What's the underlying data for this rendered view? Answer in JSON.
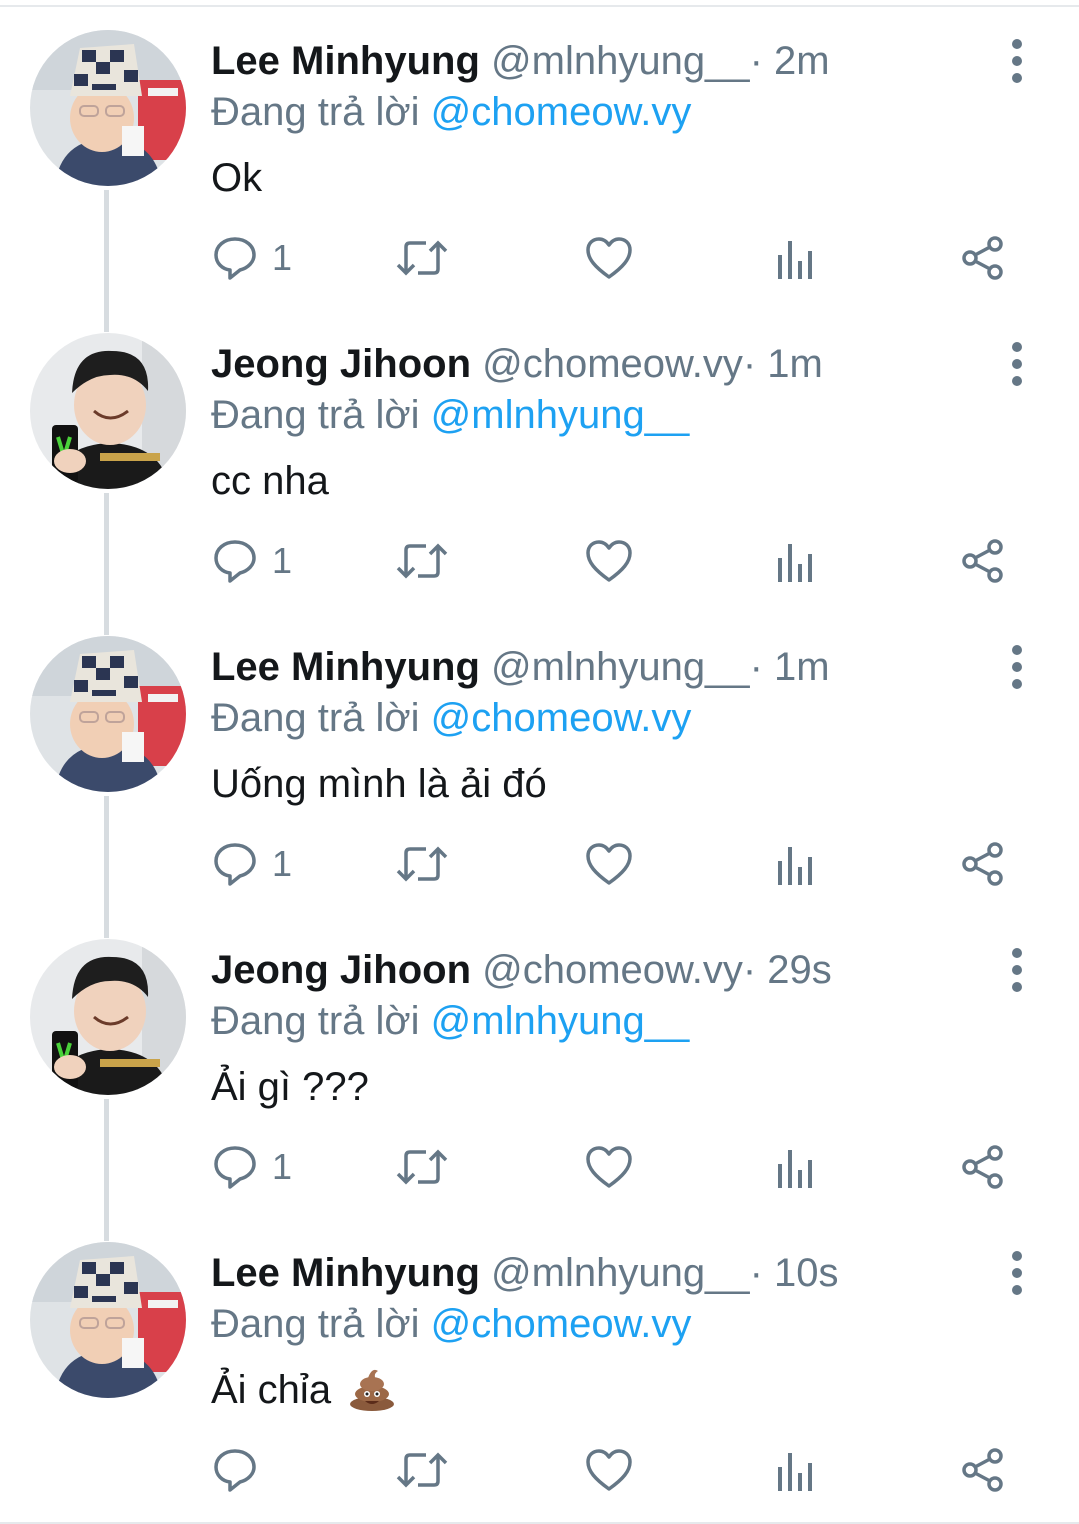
{
  "colors": {
    "text_primary": "#14171a",
    "text_secondary": "#657786",
    "mention": "#1da1f2",
    "thread_line": "#d7dce0"
  },
  "icons": [
    "comment-icon",
    "retweet-icon",
    "like-icon",
    "analytics-icon",
    "share-icon",
    "more-options-icon"
  ],
  "tweets": [
    {
      "author": "Lee Minhyung",
      "handle": "@mlnhyung__",
      "separator": "·",
      "time": "2m",
      "reply_prefix": "Đang trả lời",
      "reply_to": "@chomeow.vy",
      "text": "Ok",
      "reply_count": "1",
      "avatar": "lee"
    },
    {
      "author": "Jeong Jihoon",
      "handle": "@chomeow.vy",
      "separator": "·",
      "time": "1m",
      "reply_prefix": "Đang trả lời",
      "reply_to": "@mlnhyung__",
      "text": "cc nha",
      "reply_count": "1",
      "avatar": "jeong"
    },
    {
      "author": "Lee Minhyung",
      "handle": "@mlnhyung__",
      "separator": "·",
      "time": "1m",
      "reply_prefix": "Đang trả lời",
      "reply_to": "@chomeow.vy",
      "text": "Uống mình là ải đó",
      "reply_count": "1",
      "avatar": "lee"
    },
    {
      "author": "Jeong Jihoon",
      "handle": "@chomeow.vy",
      "separator": "·",
      "time": "29s",
      "reply_prefix": "Đang trả lời",
      "reply_to": "@mlnhyung__",
      "text": "Ải gì ???",
      "reply_count": "1",
      "avatar": "jeong"
    },
    {
      "author": "Lee Minhyung",
      "handle": "@mlnhyung__",
      "separator": "·",
      "time": "10s",
      "reply_prefix": "Đang trả lời",
      "reply_to": "@chomeow.vy",
      "text": "Ải chỉa",
      "reply_count": "",
      "avatar": "lee",
      "emoji": "pile-of-poo-emoji"
    }
  ]
}
